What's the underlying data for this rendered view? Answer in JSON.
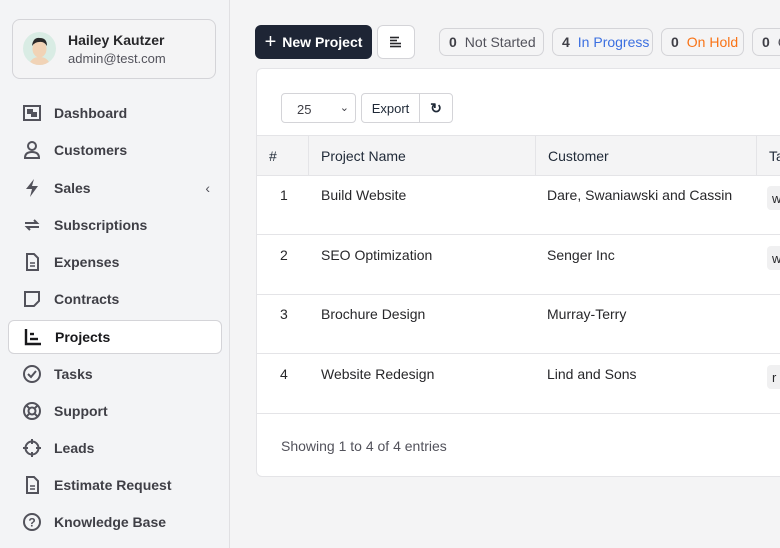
{
  "user": {
    "name": "Hailey Kautzer",
    "email": "admin@test.com"
  },
  "sidebar": {
    "items": [
      {
        "label": "Dashboard",
        "icon": "dashboard-icon"
      },
      {
        "label": "Customers",
        "icon": "user-icon"
      },
      {
        "label": "Sales",
        "icon": "bolt-icon"
      },
      {
        "label": "Subscriptions",
        "icon": "repeat-icon"
      },
      {
        "label": "Expenses",
        "icon": "file-icon"
      },
      {
        "label": "Contracts",
        "icon": "note-icon"
      },
      {
        "label": "Projects",
        "icon": "chart-icon",
        "active": true
      },
      {
        "label": "Tasks",
        "icon": "check-circle-icon"
      },
      {
        "label": "Support",
        "icon": "lifebuoy-icon"
      },
      {
        "label": "Leads",
        "icon": "crosshair-icon"
      },
      {
        "label": "Estimate Request",
        "icon": "file-icon"
      },
      {
        "label": "Knowledge Base",
        "icon": "question-icon"
      }
    ]
  },
  "toolbar": {
    "new_project": "New Project"
  },
  "status": [
    {
      "count": "0",
      "label": "Not Started",
      "color": "#52525b"
    },
    {
      "count": "4",
      "label": "In Progress",
      "color": "#3b6fe0"
    },
    {
      "count": "0",
      "label": "On Hold",
      "color": "#f97316"
    },
    {
      "count": "0",
      "label": "Cancelled",
      "color": "#52525b"
    }
  ],
  "table": {
    "page_size": "25",
    "export": "Export",
    "headers": [
      "#",
      "Project Name",
      "Customer",
      "Tags"
    ],
    "rows": [
      {
        "num": "1",
        "name": "Build Website",
        "customer": "Dare, Swaniawski and Cassin",
        "tag": "w"
      },
      {
        "num": "2",
        "name": "SEO Optimization",
        "customer": "Senger Inc",
        "tag": "w"
      },
      {
        "num": "3",
        "name": "Brochure Design",
        "customer": "Murray-Terry",
        "tag": ""
      },
      {
        "num": "4",
        "name": "Website Redesign",
        "customer": "Lind and Sons",
        "tag": "r"
      }
    ],
    "footer": "Showing 1 to 4 of 4 entries"
  }
}
